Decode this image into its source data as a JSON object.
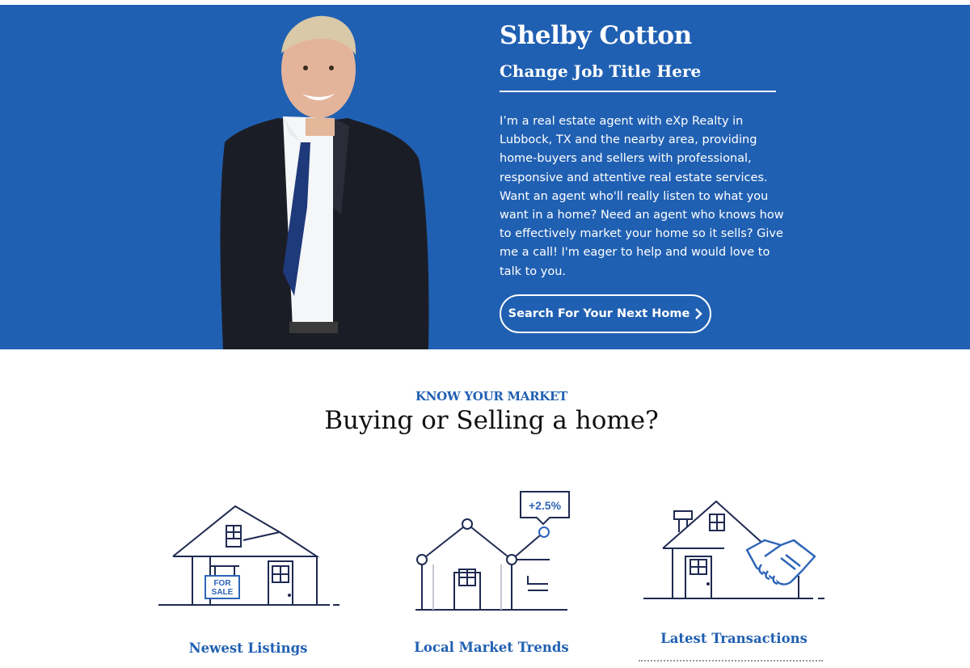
{
  "hero": {
    "agent_name": "Shelby Cotton",
    "job_title": "Change Job Title Here",
    "bio": "I’m a real estate agent with eXp Realty in Lubbock, TX and the nearby area, providing home-buyers and sellers with professional, responsive and attentive real estate services. Want an agent who'll really listen to what you want in a home? Need an agent who knows how to effectively market your home so it sells? Give me a call! I'm eager to help and would love to talk to you.",
    "cta_label": "Search For Your Next Home",
    "background_color": "#2060b2"
  },
  "market": {
    "eyebrow": "KNOW YOUR MARKET",
    "heading": "Buying or Selling a home?",
    "features": [
      {
        "label": "Newest Listings",
        "icon": "house-for-sale-icon",
        "sign_line1": "FOR",
        "sign_line2": "SALE"
      },
      {
        "label": "Local Market Trends",
        "icon": "market-trend-icon",
        "badge": "+2.5%"
      },
      {
        "label": "Latest Transactions",
        "icon": "house-handshake-icon"
      }
    ]
  },
  "colors": {
    "brand_blue": "#2060b2",
    "icon_navy": "#1f2a52",
    "icon_blue": "#2d64b8"
  }
}
